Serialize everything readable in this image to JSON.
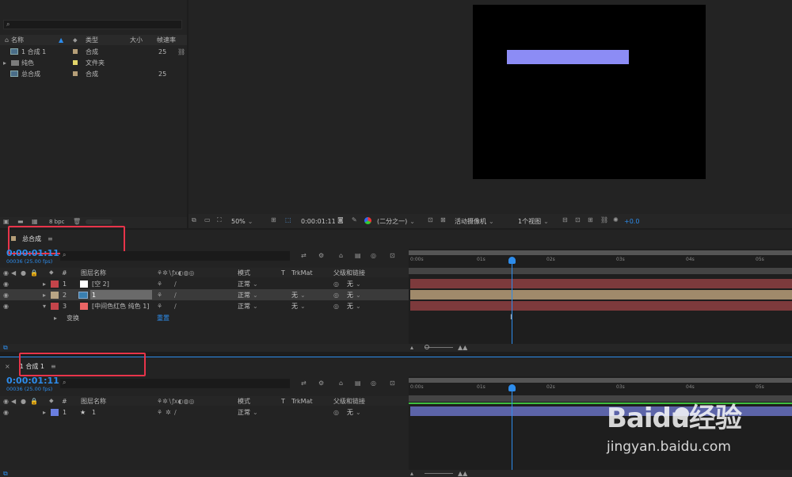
{
  "project": {
    "search_placeholder": "",
    "columns": {
      "name": "名称",
      "type": "类型",
      "size": "大小",
      "rate": "帧速率"
    },
    "items": [
      {
        "name": "1 合成 1",
        "type": "合成",
        "rate": "25",
        "tag": "#b59e78"
      },
      {
        "name": "纯色",
        "type": "文件夹",
        "rate": "",
        "tag": "#e2d56a"
      },
      {
        "name": "总合成",
        "type": "合成",
        "rate": "25",
        "tag": "#b59e78"
      }
    ],
    "bpc": "8 bpc"
  },
  "viewer": {
    "zoom": "50%",
    "timecode": "0:00:01:11",
    "resolution": "(二分之一)",
    "camera": "活动摄像机",
    "views": "1个视图",
    "exposure": "+0.0",
    "shape_color": "#8c8cf5"
  },
  "timeline1": {
    "tab_title": "总合成",
    "timecode": "0:00:01:11",
    "fps": "00036 (25.00 fps)",
    "headers": {
      "num": "#",
      "layer_name": "图层名称",
      "mode": "模式",
      "t": "T",
      "trkmat": "TrkMat",
      "parent": "父级和链接"
    },
    "layers": [
      {
        "num": "1",
        "name": "[空 2]",
        "label": "#c4444a",
        "swatch": "#ffffff",
        "mode": "正常",
        "trkmat": "",
        "parent": "无",
        "bar": "#7d3a3c"
      },
      {
        "num": "2",
        "name": "1",
        "label": "#b9a585",
        "swatch": "#3a7fb0",
        "mode": "正常",
        "trkmat": "无",
        "parent": "无",
        "bar": "#a08a6b"
      },
      {
        "num": "3",
        "name": "[中间色红色 纯色 1]",
        "label": "#c4444a",
        "swatch": "#ec6565",
        "mode": "正常",
        "trkmat": "无",
        "parent": "无",
        "bar": "#7d3a3c"
      }
    ],
    "transform_label": "变换",
    "reset_label": "重置",
    "ruler": [
      "0:00s",
      "01s",
      "02s",
      "03s",
      "04s",
      "05s"
    ]
  },
  "timeline2": {
    "tab_title": "1 合成 1",
    "timecode": "0:00:01:11",
    "fps": "00036 (25.00 fps)",
    "headers": {
      "num": "#",
      "layer_name": "图层名称",
      "mode": "模式",
      "t": "T",
      "trkmat": "TrkMat",
      "parent": "父级和链接"
    },
    "layers": [
      {
        "num": "1",
        "name": "1",
        "label": "#6a7ee0",
        "mode": "正常",
        "parent": "无",
        "bar": "#5c64a8"
      }
    ],
    "ruler": [
      "0:00s",
      "01s",
      "02s",
      "03s",
      "04s",
      "05s"
    ]
  },
  "watermark": {
    "brand": "Baidu经验",
    "url": "jingyan.baidu.com"
  },
  "colors": {
    "accent": "#2d8ceb",
    "highlight": "#e8344a"
  }
}
